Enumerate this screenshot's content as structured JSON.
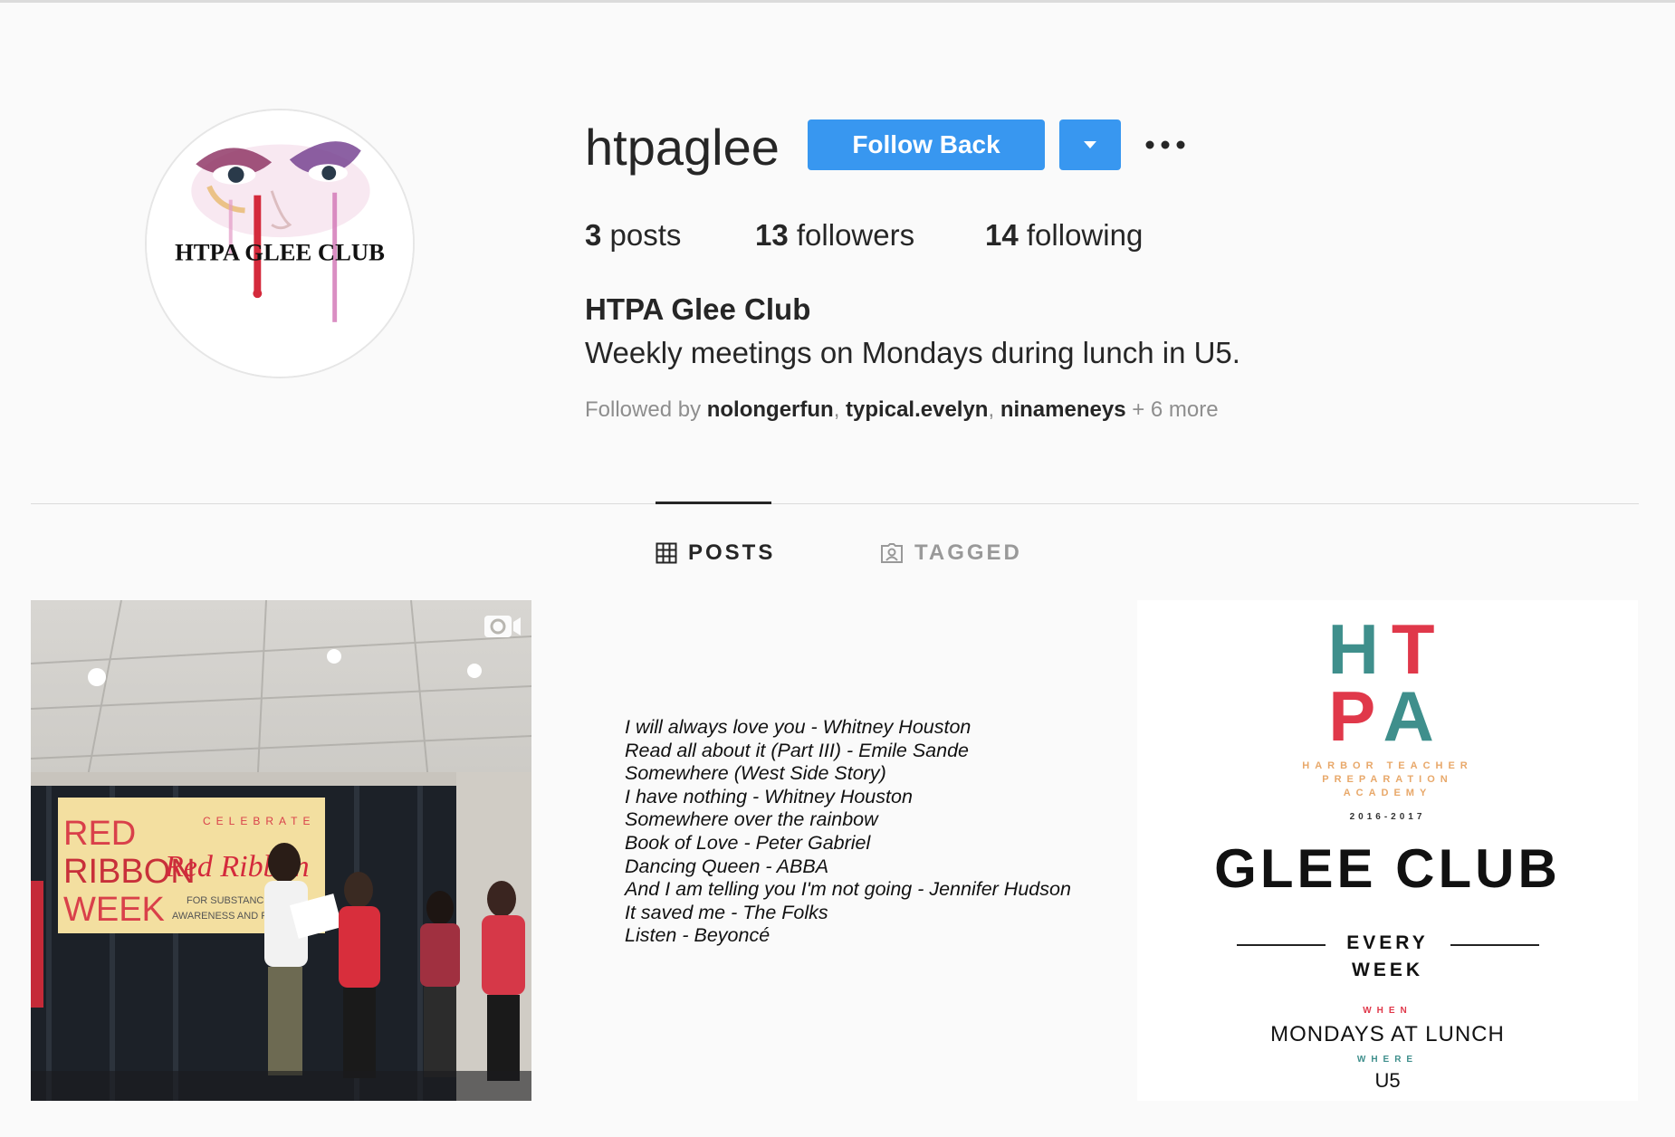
{
  "profile": {
    "avatar_text": "HTPA GLEE CLUB",
    "username": "htpaglee",
    "follow_button": "Follow Back",
    "dropdown_icon": "caret-down-icon",
    "more_icon": "ellipsis-icon",
    "stats": {
      "posts_count": "3",
      "posts_label": "posts",
      "followers_count": "13",
      "followers_label": "followers",
      "following_count": "14",
      "following_label": "following"
    },
    "full_name": "HTPA Glee Club",
    "bio": "Weekly meetings on Mondays during lunch in U5.",
    "followed_by": {
      "prefix": "Followed by ",
      "names": [
        "nolongerfun",
        "typical.evelyn",
        "ninameneys"
      ],
      "separator": ", ",
      "suffix": " + 6 more"
    }
  },
  "tabs": [
    {
      "label": "POSTS",
      "icon": "grid-icon",
      "active": true
    },
    {
      "label": "TAGGED",
      "icon": "tagged-user-icon",
      "active": false
    }
  ],
  "posts": {
    "post1": {
      "type": "video",
      "banner_text": [
        "RED",
        "RIBBON",
        "WEEK"
      ],
      "banner_script": "Red Ribbon",
      "banner_small": [
        "CELEBRATE",
        "FOR SUBSTANCE",
        "AWARENESS AND P"
      ]
    },
    "post2": {
      "lines": [
        "I will always love you - Whitney Houston",
        "Read all about it (Part III) - Emile Sande",
        "Somewhere (West Side Story)",
        "I have nothing - Whitney Houston",
        "Somewhere over the rainbow",
        "Book of Love - Peter Gabriel",
        "Dancing Queen - ABBA",
        "And I am telling you I'm not going - Jennifer Hudson",
        "It saved me - The Folks",
        "Listen - Beyoncé"
      ]
    },
    "post3": {
      "ht_h": "H",
      "ht_t": "T",
      "pa_p": "P",
      "pa_a": "A",
      "subtitle_lines": [
        "HARBOR TEACHER",
        "PREPARATION",
        "ACADEMY"
      ],
      "year": "2016-2017",
      "title": "GLEE CLUB",
      "every_lines": [
        "EVERY",
        "WEEK"
      ],
      "when_label": "WHEN",
      "when_value": "MONDAYS AT LUNCH",
      "where_label": "WHERE",
      "where_value": "U5"
    }
  },
  "colors": {
    "accent_blue": "#3897f0",
    "text_dark": "#262626",
    "text_muted": "#8e8e8e",
    "poster_teal": "#3f8f8c",
    "poster_red": "#e0384a"
  }
}
